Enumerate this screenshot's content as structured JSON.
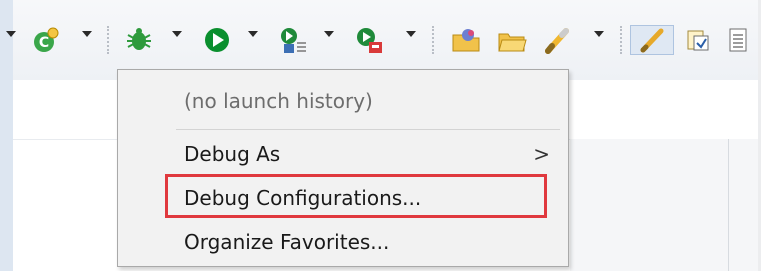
{
  "toolbar": {
    "icons": [
      "dropdown-arrow-icon",
      "new-java-class-icon",
      "debug-bug-icon",
      "run-icon",
      "run-coverage-icon",
      "external-tools-icon",
      "open-folder-icon",
      "open-folder-icon",
      "highlighter-pen-icon",
      "marker-brush-icon",
      "toggle-view-icon",
      "document-icon"
    ],
    "colors": {
      "run_green": "#0a8f2e",
      "debug_green": "#2e9a3c",
      "highlight": "#e0393e"
    }
  },
  "menu": {
    "history_label": "(no launch history)",
    "debug_as_label": "Debug As",
    "debug_as_arrow": ">",
    "debug_configurations_label": "Debug Configurations...",
    "organize_favorites_label": "Organize Favorites..."
  }
}
